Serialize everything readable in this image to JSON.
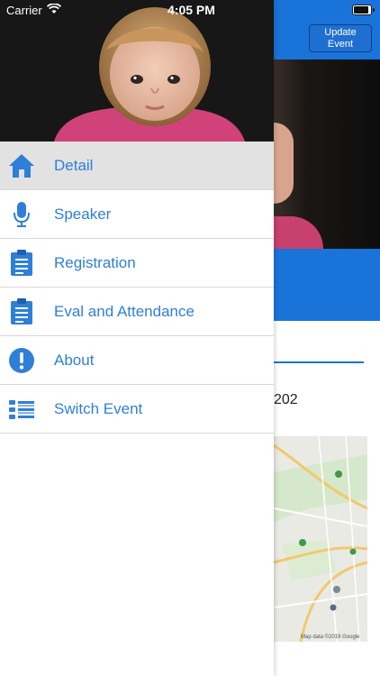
{
  "status_bar": {
    "carrier": "Carrier",
    "time": "4:05 PM",
    "battery_level": 1.0
  },
  "header": {
    "update_button_label": "Update Event"
  },
  "background": {
    "partial_text": "202",
    "map_credit": "Map data ©2019 Google"
  },
  "drawer": {
    "selected_index": 0,
    "items": [
      {
        "label": "Detail",
        "icon": "home-icon"
      },
      {
        "label": "Speaker",
        "icon": "microphone-icon"
      },
      {
        "label": "Registration",
        "icon": "clipboard-icon"
      },
      {
        "label": "Eval and Attendance",
        "icon": "clipboard-icon"
      },
      {
        "label": "About",
        "icon": "info-icon"
      },
      {
        "label": "Switch Event",
        "icon": "list-icon"
      }
    ]
  },
  "colors": {
    "accent": "#2f7fd8",
    "nav_blue": "#1a73d9",
    "selected_row": "#e2e2e2",
    "divider": "#d8d8d8"
  }
}
